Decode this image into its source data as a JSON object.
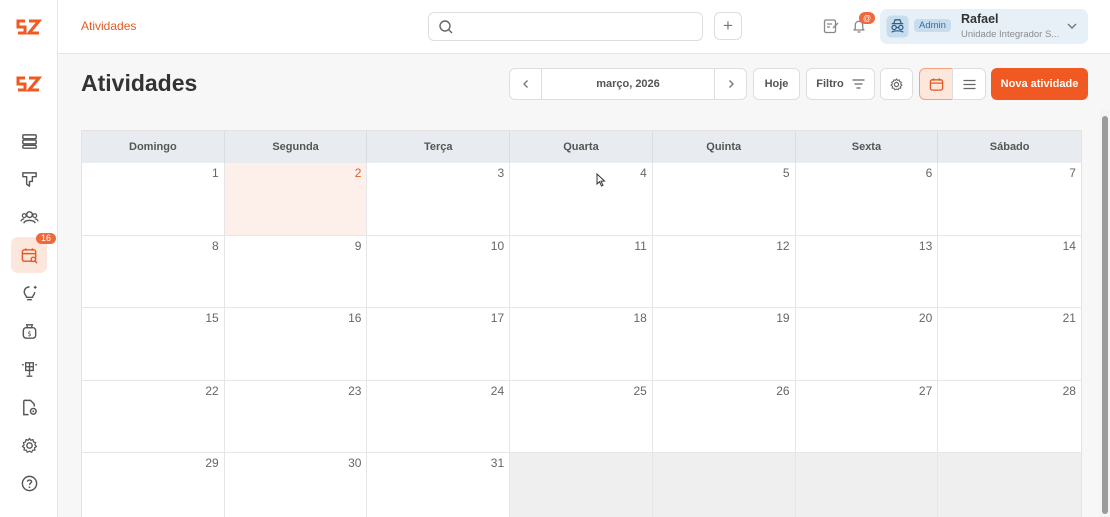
{
  "app": {
    "logo_text": "SZ"
  },
  "breadcrumb": {
    "label": "Atividades"
  },
  "search": {
    "placeholder": ""
  },
  "header": {
    "plus_label": "+",
    "notifications_count": "@"
  },
  "user": {
    "role": "Admin",
    "name": "Rafael",
    "unit": "Unidade Integrador S..."
  },
  "sidebar": {
    "items": [
      {
        "name": "sidebar-item-dashboard",
        "icon": "stack-icon"
      },
      {
        "name": "sidebar-item-pipeline",
        "icon": "funnel-icon"
      },
      {
        "name": "sidebar-item-contacts",
        "icon": "users-icon"
      },
      {
        "name": "sidebar-item-activities",
        "icon": "calendar-search-icon",
        "badge": "16",
        "active": true
      },
      {
        "name": "sidebar-item-ideas",
        "icon": "lightbulb-icon"
      },
      {
        "name": "sidebar-item-finance",
        "icon": "money-bag-icon"
      },
      {
        "name": "sidebar-item-solar",
        "icon": "solar-panel-icon"
      },
      {
        "name": "sidebar-item-documents",
        "icon": "document-gear-icon"
      },
      {
        "name": "sidebar-item-settings",
        "icon": "gear-icon"
      },
      {
        "name": "sidebar-item-help",
        "icon": "help-icon"
      }
    ]
  },
  "page": {
    "title": "Atividades"
  },
  "toolbar": {
    "month_label": "março, 2026",
    "today_label": "Hoje",
    "filter_label": "Filtro",
    "new_activity_label": "Nova atividade"
  },
  "calendar": {
    "weekdays": [
      "Domingo",
      "Segunda",
      "Terça",
      "Quarta",
      "Quinta",
      "Sexta",
      "Sábado"
    ],
    "today": "2",
    "days": [
      [
        "1",
        "2",
        "3",
        "4",
        "5",
        "6",
        "7"
      ],
      [
        "8",
        "9",
        "10",
        "11",
        "12",
        "13",
        "14"
      ],
      [
        "15",
        "16",
        "17",
        "18",
        "19",
        "20",
        "21"
      ],
      [
        "22",
        "23",
        "24",
        "25",
        "26",
        "27",
        "28"
      ],
      [
        "29",
        "30",
        "31",
        "",
        "",
        "",
        ""
      ]
    ]
  },
  "colors": {
    "accent": "#f05a22",
    "today_bg": "#fdf0ea",
    "header_bg": "#e8ecf0"
  }
}
